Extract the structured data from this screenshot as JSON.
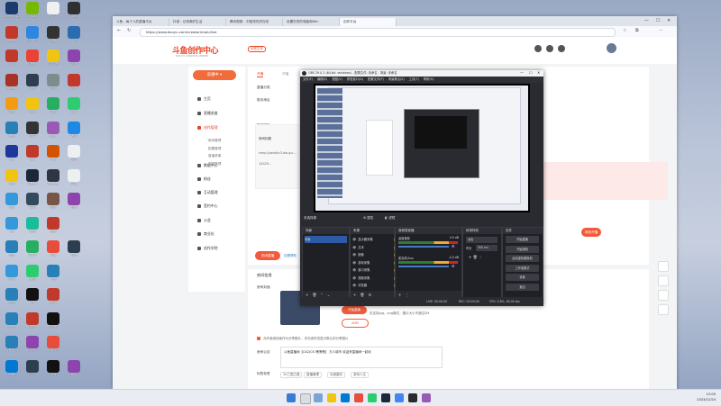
{
  "desktop": {
    "icons": [
      {
        "label": "Cinema 4D",
        "color": "#1a3b6b"
      },
      {
        "label": "NVIDIA",
        "color": "#76b900"
      },
      {
        "label": "文件",
        "color": "#f0f0f0"
      },
      {
        "label": "OBS",
        "color": "#303030"
      },
      {
        "label": "Adobe",
        "color": "#c0392b"
      },
      {
        "label": "QQ音乐",
        "color": "#2e86de"
      },
      {
        "label": "Epic",
        "color": "#333"
      },
      {
        "label": "雷电",
        "color": "#2b6cb0"
      },
      {
        "label": "AE",
        "color": "#c0392b"
      },
      {
        "label": "Gmail",
        "color": "#ea4335"
      },
      {
        "label": "文件夹",
        "color": "#f1c40f"
      },
      {
        "label": "游戏",
        "color": "#8e44ad"
      },
      {
        "label": "Access",
        "color": "#a93226"
      },
      {
        "label": "GPU",
        "color": "#2c3e50"
      },
      {
        "label": "工具",
        "color": "#7f8c8d"
      },
      {
        "label": "游戏",
        "color": "#c0392b"
      },
      {
        "label": "谷歌",
        "color": "#f39c12"
      },
      {
        "label": "设置",
        "color": "#f1c40f"
      },
      {
        "label": "剪辑",
        "color": "#27ae60"
      },
      {
        "label": "绿幕",
        "color": "#2ecc71"
      },
      {
        "label": "腾讯",
        "color": "#2980b9"
      },
      {
        "label": "剪映",
        "color": "#333"
      },
      {
        "label": "Paint",
        "color": "#9b59b6"
      },
      {
        "label": "客户",
        "color": "#1e88e5"
      },
      {
        "label": "BC",
        "color": "#1e3799"
      },
      {
        "label": "BD",
        "color": "#c0392b"
      },
      {
        "label": "HH",
        "color": "#d35400"
      },
      {
        "label": "文档",
        "color": "#ecf0f1"
      },
      {
        "label": "OBS",
        "color": "#f1c40f"
      },
      {
        "label": "Steam",
        "color": "#1b2838"
      },
      {
        "label": "Blender",
        "color": "#2f3542"
      },
      {
        "label": "文本",
        "color": "#ecf0f1"
      },
      {
        "label": "工具",
        "color": "#3498db"
      },
      {
        "label": "录制",
        "color": "#34495e"
      },
      {
        "label": "游戏",
        "color": "#795548"
      },
      {
        "label": "视频",
        "color": "#8e44ad"
      },
      {
        "label": "QQ",
        "color": "#3498db"
      },
      {
        "label": "微信",
        "color": "#1abc9c"
      },
      {
        "label": "游戏",
        "color": "#c0392b"
      },
      {
        "label": "",
        "color": "rgba(0,0,0,0)"
      },
      {
        "label": "宽屏",
        "color": "#2980b9"
      },
      {
        "label": "XBOX",
        "color": "#27ae60"
      },
      {
        "label": "直播",
        "color": "#e74c3c"
      },
      {
        "label": "视频",
        "color": "#2c3e50"
      },
      {
        "label": "电脑",
        "color": "#3498db"
      },
      {
        "label": "微信",
        "color": "#2ecc71"
      },
      {
        "label": "飞书",
        "color": "#2980b9"
      },
      {
        "label": "",
        "color": "rgba(0,0,0,0)"
      },
      {
        "label": "WPS",
        "color": "#2980b9"
      },
      {
        "label": "Z",
        "color": "#111"
      },
      {
        "label": "网易",
        "color": "#c0392b"
      },
      {
        "label": "",
        "color": "rgba(0,0,0,0)"
      },
      {
        "label": "远程",
        "color": "#2980b9"
      },
      {
        "label": "游戏",
        "color": "#c0392b"
      },
      {
        "label": "抖音",
        "color": "#111"
      },
      {
        "label": "",
        "color": "rgba(0,0,0,0)"
      },
      {
        "label": "截图",
        "color": "#2980b9"
      },
      {
        "label": "游戏",
        "color": "#8e44ad"
      },
      {
        "label": "网易",
        "color": "#e74c3c"
      },
      {
        "label": "",
        "color": "rgba(0,0,0,0)"
      },
      {
        "label": "Edge",
        "color": "#0078d4"
      },
      {
        "label": "工具",
        "color": "#2c3e50"
      },
      {
        "label": "游戏",
        "color": "#111"
      },
      {
        "label": "网易",
        "color": "#8e44ad"
      }
    ]
  },
  "browser": {
    "tabs": [
      "斗鱼 - 每个人的直播平台",
      "抖音 - 记录美好生活",
      "腾讯视频 - 中国领先的在线",
      "设置在您的电脑和Win",
      "创作平台"
    ],
    "url": "https://www.douyu.com/creator/main/live"
  },
  "site": {
    "logo": "斗鱼创作中心",
    "logo_sub": "DOUYU CREATOR CENTER",
    "version": "标签文本",
    "sidebar": {
      "live_button": "直播中",
      "items": [
        {
          "label": "主页",
          "sel": false
        },
        {
          "label": "直播进度",
          "sel": false
        },
        {
          "label": "创作管理",
          "sel": true
        },
        {
          "label": "数据中心",
          "sel": false
        },
        {
          "label": "粉丝",
          "sel": false
        },
        {
          "label": "互动管理",
          "sel": false
        },
        {
          "label": "签约中心",
          "sel": false
        },
        {
          "label": "公会",
          "sel": false
        },
        {
          "label": "商业化",
          "sel": false
        },
        {
          "label": "创作学院",
          "sel": false
        }
      ],
      "subitems": [
        "房间管理",
        "配置管理",
        "直播录像",
        "视频管理"
      ]
    },
    "card": {
      "tabs": [
        "开播",
        "开播"
      ],
      "label_live_type": "直播分类",
      "label_platform": "推流地址",
      "label_push": "推流密码",
      "label_room_title": "房间标题",
      "push_text": "rtmp://sendtc3.douyu.com/live",
      "push_key": "14429...",
      "stop_btn": "关闭直播",
      "stop_link": "如需帮助",
      "room_section": "房间信息",
      "cover_label": "房间封面",
      "upload_btn": "开始直播",
      "upload_sub": "AMM",
      "cover_tip": "仅支持jpg、png格式，图片大小不超过2M",
      "checkbox_text": "允许使用封面作为分享图片，未勾选时将显示默认的分享图片",
      "notice_label": "房间公告",
      "notice_text": "斗鱼直播间【CK2|CK 嘿嘿嘿】 万人城市 欢迎来直播间一起玩",
      "tags_label": "标签标签",
      "tags": [
        "3d三国之路",
        "直播管理",
        "动漫星际",
        "游戏人生"
      ],
      "room_url": "douyu.com/14429",
      "rule_link": "直播管理"
    },
    "notice_box": "温馨提示：请遵守直播规范",
    "live_enter_btn": "网页开播"
  },
  "obs": {
    "title": "OBS 29.0.2 (64-bit, windows) - 配置文件: 未命名 - 场景: 未命名",
    "menu": [
      "文件(F)",
      "编辑(E)",
      "视图(V)",
      "停靠窗口(D)",
      "配置文件(P)",
      "场景集合(S)",
      "工具(T)",
      "帮助(H)"
    ],
    "no_source": "未选择源",
    "props_btn": "属性",
    "filters_btn": "滤镜",
    "docks": {
      "scenes": "场景",
      "sources": "来源",
      "mixer": "音频混音器",
      "transitions": "转场特效",
      "controls": "控件"
    },
    "scene_items": [
      "场景"
    ],
    "source_items": [
      "显示器采集",
      "文本",
      "图像",
      "游戏采集",
      "窗口采集",
      "视频采集",
      "浏览器"
    ],
    "mixer": [
      {
        "name": "桌面音频",
        "db": "0.0 dB"
      },
      {
        "name": "麦克风/Aux",
        "db": "-4.0 dB"
      }
    ],
    "transition": "淡出",
    "duration_label": "时长",
    "duration": "300 ms",
    "controls": [
      "开始直播",
      "开始录制",
      "启动虚拟摄像机",
      "工作室模式",
      "设置",
      "退出"
    ],
    "status": {
      "live": "LIVE: 00:00:00",
      "rec": "REC: 00:00:00",
      "cpu": "CPU: 0.8%, 60.00 fps"
    }
  },
  "taskbar": {
    "time": "12:05",
    "date": "2023/12/24"
  }
}
